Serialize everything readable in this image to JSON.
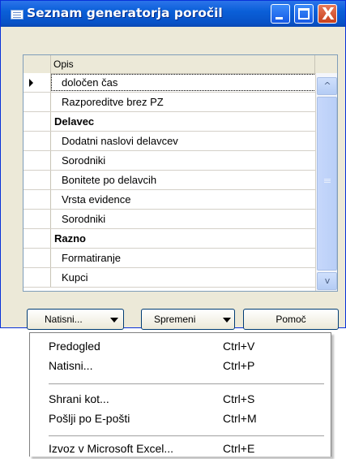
{
  "window": {
    "title": "Seznam generatorja poročil",
    "close_glyph": "X"
  },
  "table": {
    "column_header": "Opis",
    "rows": [
      {
        "label": "določen čas",
        "type": "item",
        "current": true
      },
      {
        "label": "Razporeditve brez PZ",
        "type": "item"
      },
      {
        "label": "Delavec",
        "type": "group"
      },
      {
        "label": "Dodatni naslovi delavcev",
        "type": "item"
      },
      {
        "label": "Sorodniki",
        "type": "item"
      },
      {
        "label": "Bonitete po delavcih",
        "type": "item"
      },
      {
        "label": "Vrsta evidence",
        "type": "item"
      },
      {
        "label": "Sorodniki",
        "type": "item"
      },
      {
        "label": "Razno",
        "type": "group"
      },
      {
        "label": "Formatiranje",
        "type": "item"
      },
      {
        "label": "Kupci",
        "type": "item"
      }
    ],
    "scroll_up_glyph": "^",
    "scroll_down_glyph": "v"
  },
  "buttons": {
    "print": "Natisni...",
    "modify": "Spremeni",
    "help": "Pomoč"
  },
  "menu": {
    "items": [
      {
        "label": "Predogled",
        "shortcut": "Ctrl+V"
      },
      {
        "label": "Natisni...",
        "shortcut": "Ctrl+P"
      },
      {
        "label": "Shrani kot...",
        "shortcut": "Ctrl+S"
      },
      {
        "label": "Pošlji po E-pošti",
        "shortcut": "Ctrl+M"
      },
      {
        "label": "Izvoz v Microsoft Excel...",
        "shortcut": "Ctrl+E"
      }
    ]
  },
  "colors": {
    "titlebar": "#0a5fd8",
    "window_face": "#ece9d8",
    "close_button": "#c8401c"
  }
}
